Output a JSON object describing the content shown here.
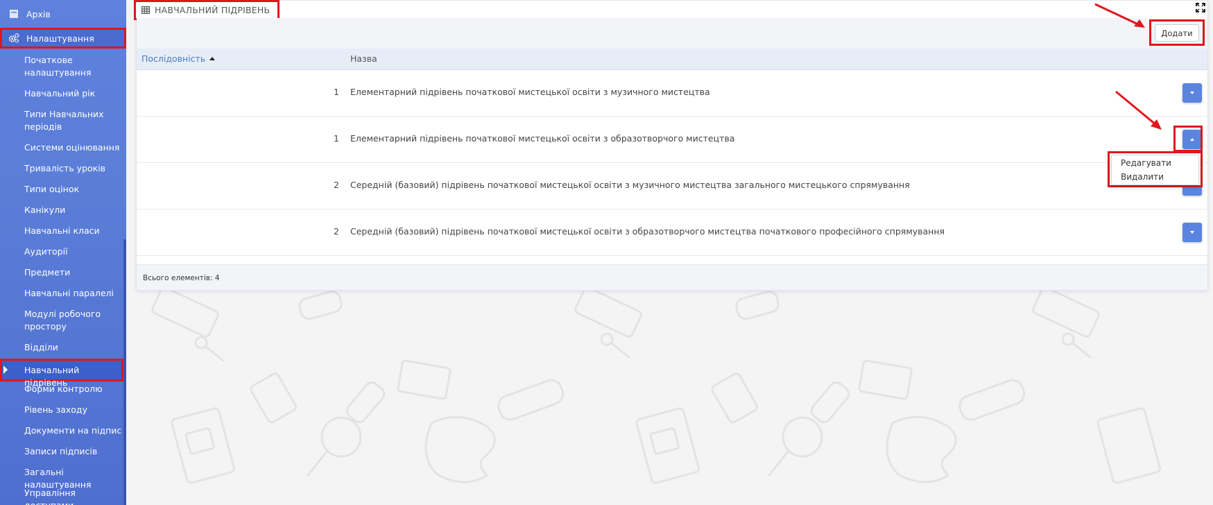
{
  "sidebar": {
    "archive_label": "Архів",
    "settings_label": "Налаштування",
    "items": [
      "Початкове налаштування",
      "Навчальний рік",
      "Типи Навчальних періодів",
      "Системи оцінювання",
      "Тривалість уроків",
      "Типи оцінок",
      "Канікули",
      "Навчальні класи",
      "Аудиторії",
      "Предмети",
      "Навчальні паралелі",
      "Модулі робочого простору",
      "Відділи",
      "Навчальний підрівень",
      "Форми контролю",
      "Рівень заходу",
      "Документи на підпис",
      "Записи підписів",
      "Загальні налаштування",
      "Управління доступами"
    ],
    "active_item": "Навчальний підрівень"
  },
  "panel": {
    "title": "НАВЧАЛЬНИЙ ПІДРІВЕНЬ",
    "add_button": "Додати",
    "columns": {
      "sequence": "Послідовність",
      "name": "Назва"
    },
    "rows": [
      {
        "seq": "1",
        "name": "Елементарний підрівень початкової мистецької освіти з музичного мистецтва"
      },
      {
        "seq": "1",
        "name": "Елементарний підрівень початкової мистецької освіти з образотворчого мистецтва"
      },
      {
        "seq": "2",
        "name": "Середній (базовий) підрівень початкової мистецької освіти з музичного мистецтва загального мистецького спрямування"
      },
      {
        "seq": "2",
        "name": "Середній (базовий) підрівень початкової мистецької освіти з образотворчого мистецтва початкового професійного спрямування"
      }
    ],
    "dropdown": {
      "edit": "Редагувати",
      "delete": "Видалити"
    },
    "total": "Всього елементів: 4"
  },
  "colors": {
    "sidebar": "#5a7dd8",
    "accent_button": "#5b84e0",
    "highlight": "#e0161c"
  }
}
